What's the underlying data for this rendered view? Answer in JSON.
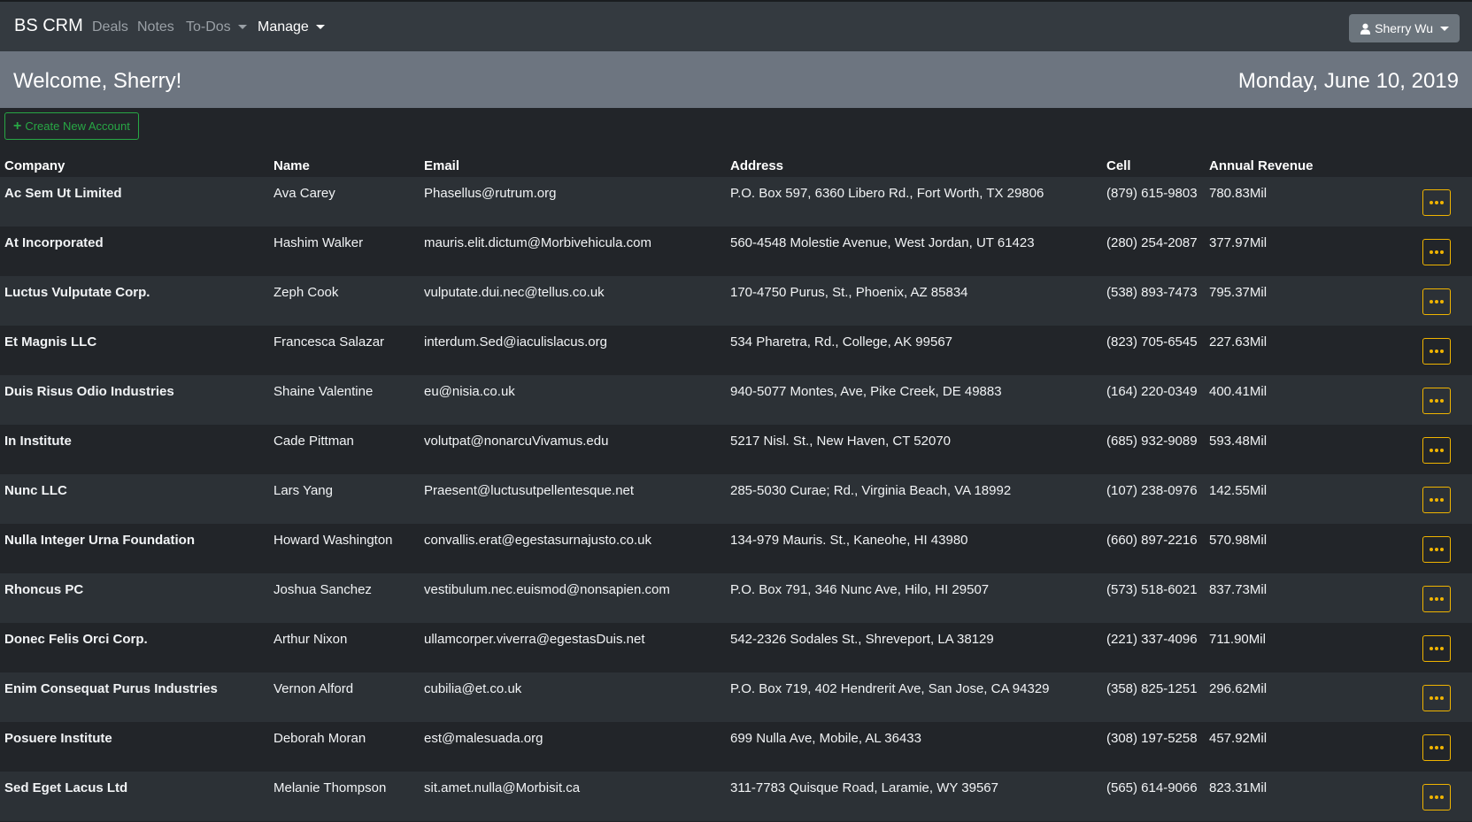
{
  "nav": {
    "brand": "BS CRM",
    "links": [
      "Deals",
      "Notes",
      "To-Dos"
    ],
    "manage": "Manage",
    "user": "Sherry Wu"
  },
  "welcome": {
    "greeting": "Welcome, Sherry!",
    "date": "Monday, June 10, 2019"
  },
  "actions": {
    "create_label": "Create New Account"
  },
  "table": {
    "headers": [
      "Company",
      "Name",
      "Email",
      "Address",
      "Cell",
      "Annual Revenue"
    ],
    "rows": [
      {
        "company": "Ac Sem Ut Limited",
        "name": "Ava Carey",
        "email": "Phasellus@rutrum.org",
        "address": "P.O. Box 597, 6360 Libero Rd., Fort Worth, TX 29806",
        "cell": "(879) 615-9803",
        "revenue": "780.83Mil"
      },
      {
        "company": "At Incorporated",
        "name": "Hashim Walker",
        "email": "mauris.elit.dictum@Morbivehicula.com",
        "address": "560-4548 Molestie Avenue, West Jordan, UT 61423",
        "cell": "(280) 254-2087",
        "revenue": "377.97Mil"
      },
      {
        "company": "Luctus Vulputate Corp.",
        "name": "Zeph Cook",
        "email": "vulputate.dui.nec@tellus.co.uk",
        "address": "170-4750 Purus, St., Phoenix, AZ 85834",
        "cell": "(538) 893-7473",
        "revenue": "795.37Mil"
      },
      {
        "company": "Et Magnis LLC",
        "name": "Francesca Salazar",
        "email": "interdum.Sed@iaculislacus.org",
        "address": "534 Pharetra, Rd., College, AK 99567",
        "cell": "(823) 705-6545",
        "revenue": "227.63Mil"
      },
      {
        "company": "Duis Risus Odio Industries",
        "name": "Shaine Valentine",
        "email": "eu@nisia.co.uk",
        "address": "940-5077 Montes, Ave, Pike Creek, DE 49883",
        "cell": "(164) 220-0349",
        "revenue": "400.41Mil"
      },
      {
        "company": "In Institute",
        "name": "Cade Pittman",
        "email": "volutpat@nonarcuVivamus.edu",
        "address": "5217 Nisl. St., New Haven, CT 52070",
        "cell": "(685) 932-9089",
        "revenue": "593.48Mil"
      },
      {
        "company": "Nunc LLC",
        "name": "Lars Yang",
        "email": "Praesent@luctusutpellentesque.net",
        "address": "285-5030 Curae; Rd., Virginia Beach, VA 18992",
        "cell": "(107) 238-0976",
        "revenue": "142.55Mil"
      },
      {
        "company": "Nulla Integer Urna Foundation",
        "name": "Howard Washington",
        "email": "convallis.erat@egestasurnajusto.co.uk",
        "address": "134-979 Mauris. St., Kaneohe, HI 43980",
        "cell": "(660) 897-2216",
        "revenue": "570.98Mil"
      },
      {
        "company": "Rhoncus PC",
        "name": "Joshua Sanchez",
        "email": "vestibulum.nec.euismod@nonsapien.com",
        "address": "P.O. Box 791, 346 Nunc Ave, Hilo, HI 29507",
        "cell": "(573) 518-6021",
        "revenue": "837.73Mil"
      },
      {
        "company": "Donec Felis Orci Corp.",
        "name": "Arthur Nixon",
        "email": "ullamcorper.viverra@egestasDuis.net",
        "address": "542-2326 Sodales St., Shreveport, LA 38129",
        "cell": "(221) 337-4096",
        "revenue": "711.90Mil"
      },
      {
        "company": "Enim Consequat Purus Industries",
        "name": "Vernon Alford",
        "email": "cubilia@et.co.uk",
        "address": "P.O. Box 719, 402 Hendrerit Ave, San Jose, CA 94329",
        "cell": "(358) 825-1251",
        "revenue": "296.62Mil"
      },
      {
        "company": "Posuere Institute",
        "name": "Deborah Moran",
        "email": "est@malesuada.org",
        "address": "699 Nulla Ave, Mobile, AL 36433",
        "cell": "(308) 197-5258",
        "revenue": "457.92Mil"
      },
      {
        "company": "Sed Eget Lacus Ltd",
        "name": "Melanie Thompson",
        "email": "sit.amet.nulla@Morbisit.ca",
        "address": "311-7783 Quisque Road, Laramie, WY 39567",
        "cell": "(565) 614-9066",
        "revenue": "823.31Mil"
      }
    ]
  },
  "colors": {
    "navbar": "#343a40",
    "welcome_bar": "#6d7580",
    "create_green": "#28a745",
    "link_blue": "#1e7fe0",
    "more_yellow": "#f0b400"
  }
}
